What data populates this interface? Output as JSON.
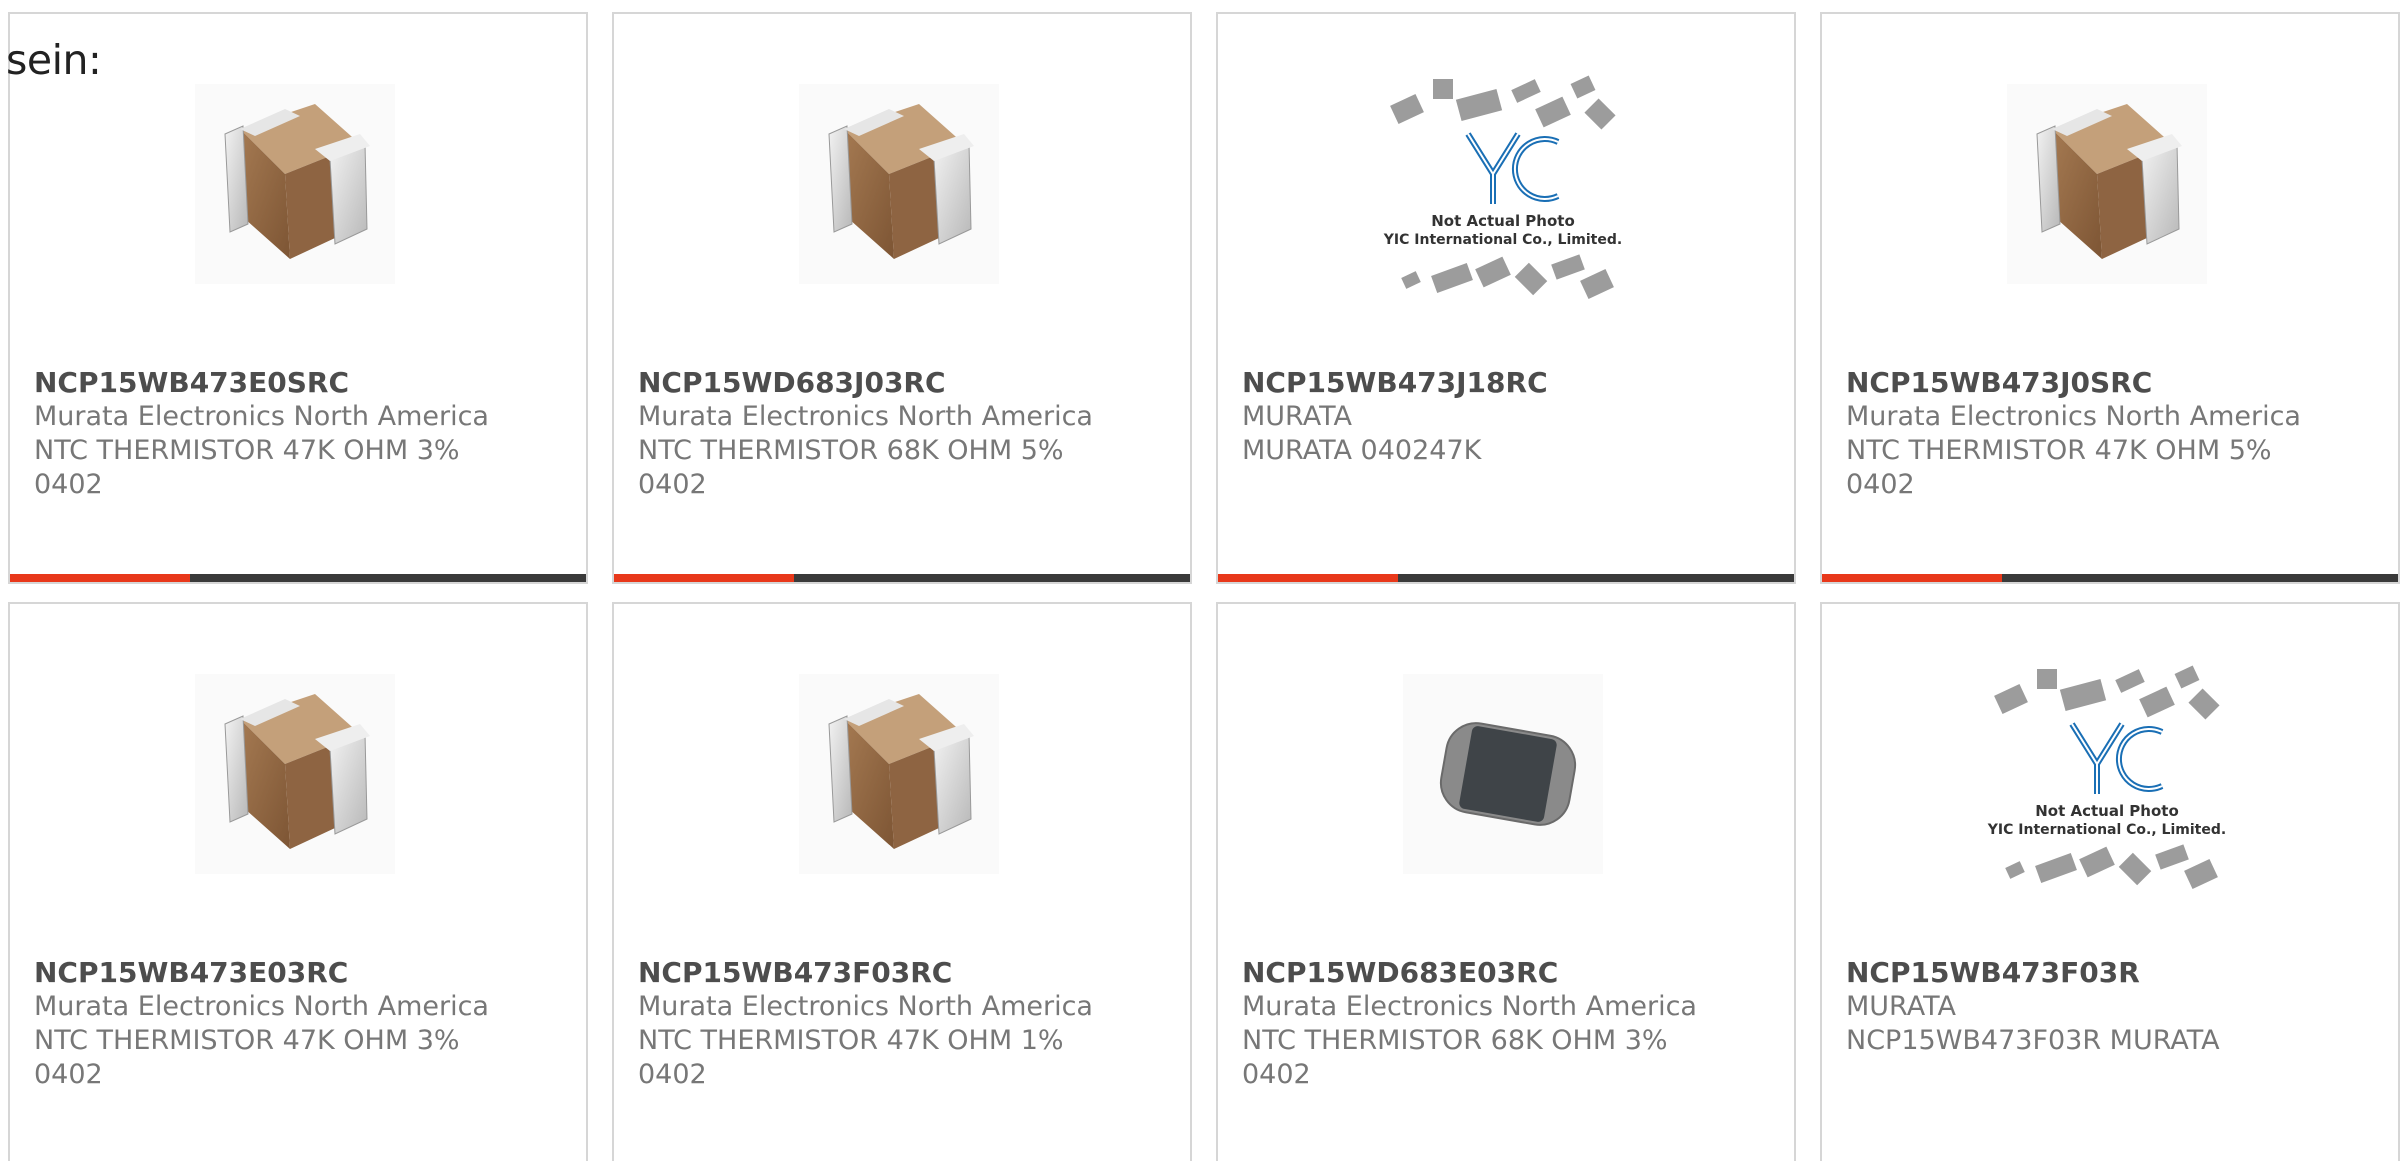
{
  "intro_text": "sein:",
  "accent_color": "#e8381a",
  "bar_color": "#3a3a3a",
  "products": [
    {
      "part_number": "NCP15WB473E0SRC",
      "manufacturer": "Murata Electronics North America",
      "description": "NTC THERMISTOR 47K OHM 3%",
      "package": "0402",
      "image": "smd-capacitor-icon"
    },
    {
      "part_number": "NCP15WD683J03RC",
      "manufacturer": "Murata Electronics North America",
      "description": "NTC THERMISTOR 68K OHM 5%",
      "package": "0402",
      "image": "smd-capacitor-icon"
    },
    {
      "part_number": "NCP15WB473J18RC",
      "manufacturer": "MURATA",
      "description": "MURATA 040247K",
      "package": "",
      "image": "yic-placeholder-icon",
      "placeholder_line1": "Not Actual Photo",
      "placeholder_line2": "YIC International Co., Limited."
    },
    {
      "part_number": "NCP15WB473J0SRC",
      "manufacturer": "Murata Electronics North America",
      "description": "NTC THERMISTOR 47K OHM 5%",
      "package": "0402",
      "image": "smd-capacitor-icon"
    },
    {
      "part_number": "NCP15WB473E03RC",
      "manufacturer": "Murata Electronics North America",
      "description": "NTC THERMISTOR 47K OHM 3%",
      "package": "0402",
      "image": "smd-capacitor-icon"
    },
    {
      "part_number": "NCP15WB473F03RC",
      "manufacturer": "Murata Electronics North America",
      "description": "NTC THERMISTOR 47K OHM 1%",
      "package": "0402",
      "image": "smd-capacitor-icon"
    },
    {
      "part_number": "NCP15WD683E03RC",
      "manufacturer": "Murata Electronics North America",
      "description": "NTC THERMISTOR 68K OHM 3%",
      "package": "0402",
      "image": "smd-thermistor-icon"
    },
    {
      "part_number": "NCP15WB473F03R",
      "manufacturer": "MURATA",
      "description": "NCP15WB473F03R MURATA",
      "package": "",
      "image": "yic-placeholder-icon",
      "placeholder_line1": "Not Actual Photo",
      "placeholder_line2": "YIC International Co., Limited."
    }
  ]
}
